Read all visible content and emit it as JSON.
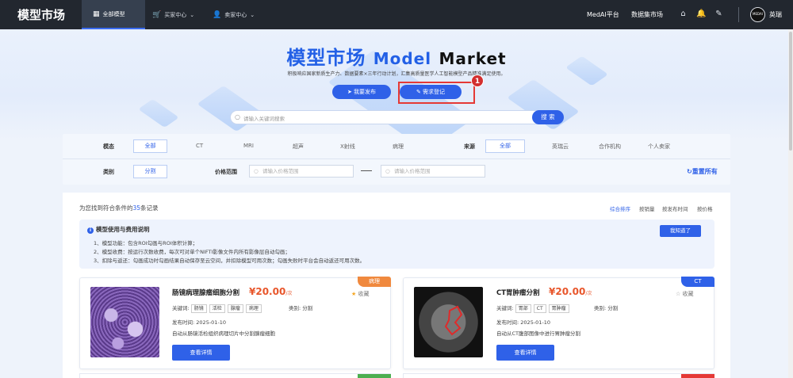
{
  "topbar": {
    "brand": "模型市场",
    "nav": [
      {
        "label": "全部模型",
        "active": true
      },
      {
        "label": "买家中心"
      },
      {
        "label": "卖家中心"
      }
    ],
    "right_links": [
      "MedAI平台",
      "数据集市场"
    ],
    "avatar_text": "MEDAI",
    "user_name": "英瑞"
  },
  "hero": {
    "title_cn": "模型市场",
    "title_model": "Model",
    "title_market": "Market",
    "subtitle": "积极响应国家新质生产力、数据要素×三年行动计划，汇集高质量医学人工智能模型产品精准满足使用。",
    "publish_button": "我要发布",
    "request_button": "需求登记",
    "annotation_number": "1"
  },
  "search": {
    "placeholder": "请输入关键词搜索",
    "button": "搜 索"
  },
  "filters": {
    "modality_label": "模态",
    "modality_options": [
      "全部",
      "CT",
      "MRI",
      "超声",
      "X射线",
      "病理"
    ],
    "source_label": "来源",
    "source_options": [
      "全部",
      "英瑞云",
      "合作机构",
      "个人卖家"
    ],
    "category_label": "类别",
    "category_selected": "分割",
    "price_label": "价格范围",
    "price_min_placeholder": "请输入价格范围",
    "price_max_placeholder": "请输入价格范围",
    "reset": "重置所有"
  },
  "results": {
    "count_prefix": "为您找到符合条件的",
    "count": "35",
    "count_suffix": "条记录",
    "sort_options": [
      "综合排序",
      "按销量",
      "按发布时间",
      "按价格"
    ]
  },
  "notice": {
    "title": "模型使用与费用说明",
    "lines": [
      "1、模型功能：包含ROI勾画与ROI体积计算；",
      "2、模型收费：按运行次数收费，每次可对单个NIFTI影像文件内所有影像层自动勾画；",
      "3、扣除与返还：勾画成功时勾画结果自动保存至云空间，并扣除模型可用次数；勾画失败时平台会自动返还可用次数。"
    ],
    "ack_button": "我知道了"
  },
  "cards": [
    {
      "tag": "病理",
      "tag_color": "#f0893e",
      "title": "肠镜病理腺瘤细胞分割",
      "price": "¥20.00",
      "price_unit": "/次",
      "favorite": "收藏",
      "favorited": true,
      "keywords_label": "关键词:",
      "keywords": [
        "肠镜",
        "活检",
        "腺瘤",
        "病理"
      ],
      "category_label": "类别:",
      "category": "分割",
      "date_label": "发布时间:",
      "date": "2025-01-10",
      "description": "自动从肠镜活检组织病理切片中分割腺瘤细胞",
      "detail_button": "查看详情"
    },
    {
      "tag": "CT",
      "tag_color": "#2f61e8",
      "title": "CT胃肿瘤分割",
      "price": "¥20.00",
      "price_unit": "/次",
      "favorite": "收藏",
      "favorited": false,
      "keywords_label": "关键词:",
      "keywords": [
        "胃部",
        "CT",
        "胃肿瘤"
      ],
      "category_label": "类别:",
      "category": "分割",
      "date_label": "发布时间:",
      "date": "2025-01-10",
      "description": "自动从CT腹部图像中进行胃肿瘤分割",
      "detail_button": "查看详情"
    }
  ]
}
